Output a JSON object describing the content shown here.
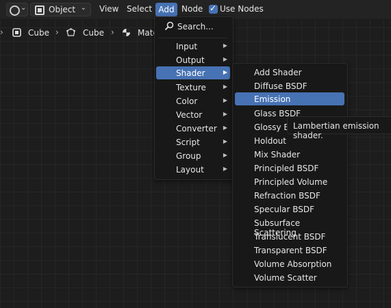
{
  "header": {
    "mode_label": "Object",
    "menus": {
      "view": "View",
      "select": "Select",
      "add": "Add",
      "node": "Node"
    },
    "use_nodes_label": "Use Nodes",
    "use_nodes_checked": true
  },
  "breadcrumb": {
    "items": [
      "Cube",
      "Cube",
      "Mate"
    ]
  },
  "add_menu": {
    "search_label": "Search...",
    "items": [
      "Input",
      "Output",
      "Shader",
      "Texture",
      "Color",
      "Vector",
      "Converter",
      "Script",
      "Group",
      "Layout"
    ],
    "active_item": "Shader"
  },
  "shader_menu": {
    "items": [
      "Add Shader",
      "Diffuse BSDF",
      "Emission",
      "Glass BSDF",
      "Glossy B",
      "Holdout",
      "Mix Shader",
      "Principled BSDF",
      "Principled Volume",
      "Refraction BSDF",
      "Specular BSDF",
      "Subsurface Scattering",
      "Translucent BSDF",
      "Transparent BSDF",
      "Volume Absorption",
      "Volume Scatter"
    ],
    "active_item": "Emission"
  },
  "tooltip": {
    "text": "Lambertian emission shader."
  },
  "colors": {
    "accent": "#4772b3",
    "background": "#1d1d1d",
    "menu_bg": "#181818"
  }
}
